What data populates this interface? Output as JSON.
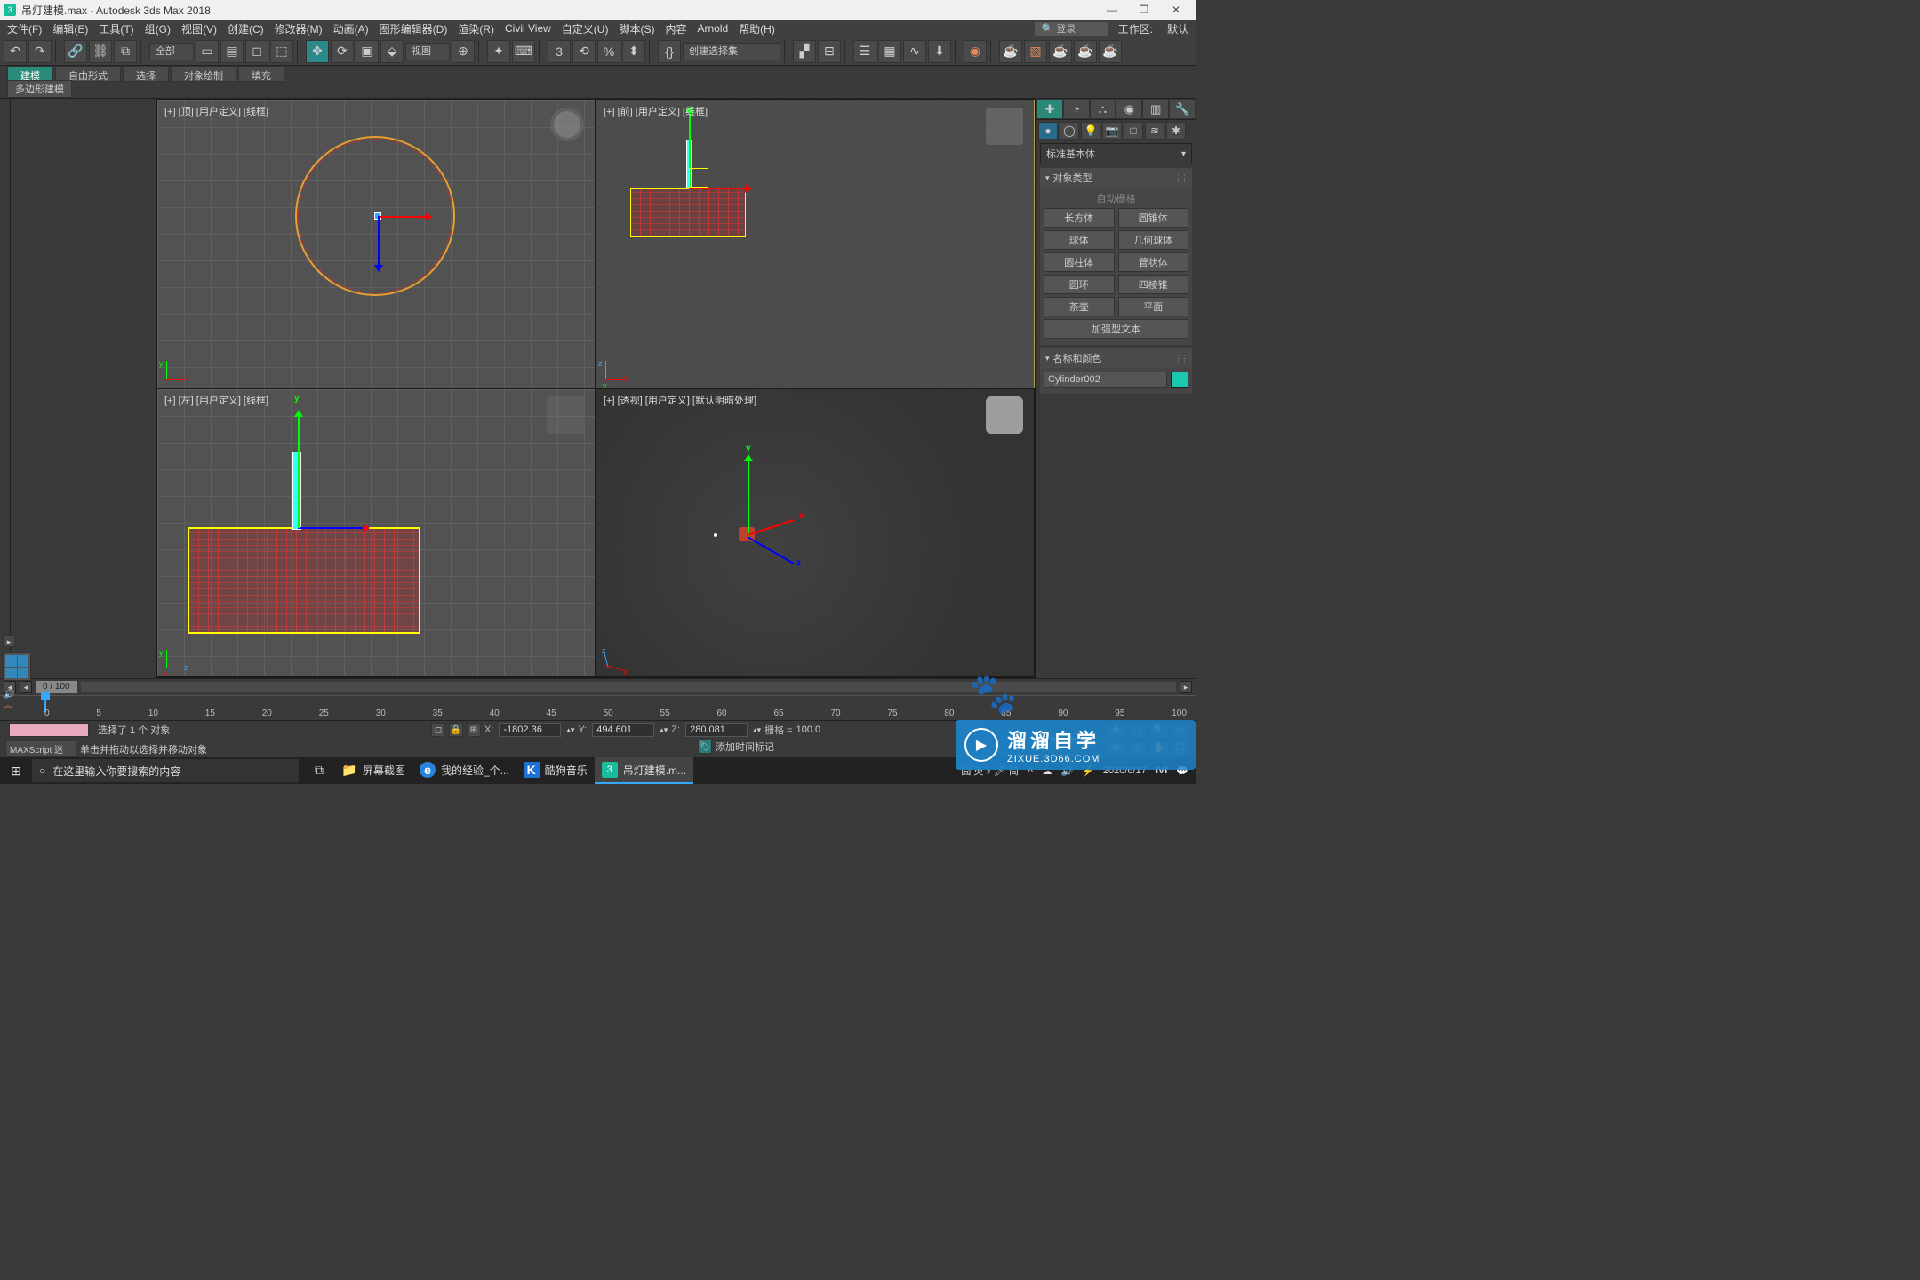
{
  "title": "吊灯建模.max - Autodesk 3ds Max 2018",
  "window": {
    "min": "—",
    "max": "❐",
    "close": "✕"
  },
  "menu": [
    "文件(F)",
    "编辑(E)",
    "工具(T)",
    "组(G)",
    "视图(V)",
    "创建(C)",
    "修改器(M)",
    "动画(A)",
    "图形编辑器(D)",
    "渲染(R)",
    "Civil View",
    "自定义(U)",
    "脚本(S)",
    "内容",
    "Arnold",
    "帮助(H)"
  ],
  "menuRight": {
    "search": "🔍 登录",
    "workspace_lbl": "工作区:",
    "workspace": "默认"
  },
  "toolbar": {
    "scope": "全部",
    "view": "视图",
    "namedsel": "创建选择集"
  },
  "ribbon": {
    "tabs": [
      "建模",
      "自由形式",
      "选择",
      "对象绘制",
      "填充"
    ],
    "sub": "多边形建模"
  },
  "viewports": {
    "vp1": "[+] [顶] [用户定义] [线框]",
    "vp2": "[+] [前] [用户定义] [线框]",
    "vp3": "[+] [左] [用户定义] [线框]",
    "vp4": "[+] [透视] [用户定义] [默认明暗处理]"
  },
  "cmd": {
    "dropdown": "标准基本体",
    "rollout1": "对象类型",
    "autogrid": "自动栅格",
    "types": [
      [
        "长方体",
        "圆锥体"
      ],
      [
        "球体",
        "几何球体"
      ],
      [
        "圆柱体",
        "管状体"
      ],
      [
        "圆环",
        "四棱锥"
      ],
      [
        "茶壶",
        "平面"
      ],
      [
        "加强型文本",
        ""
      ]
    ],
    "rollout2": "名称和颜色",
    "objname": "Cylinder002"
  },
  "timeline": {
    "frame": "0 / 100",
    "ticks": [
      "0",
      "5",
      "10",
      "15",
      "20",
      "25",
      "30",
      "35",
      "40",
      "45",
      "50",
      "55",
      "60",
      "65",
      "70",
      "75",
      "80",
      "85",
      "90",
      "95",
      "100"
    ]
  },
  "status": {
    "sel": "选择了 1 个 对象",
    "prompt": "单击并拖动以选择并移动对象",
    "maxscript": "MAXScript 迷",
    "x_lbl": "X:",
    "x": "-1802.36",
    "y_lbl": "Y:",
    "y": "494.601",
    "z_lbl": "Z:",
    "z": "280.081",
    "grid_lbl": "栅格 =",
    "grid": "100.0",
    "addtime": "添加时间标记"
  },
  "taskbar": {
    "search_ph": "在这里输入你要搜索的内容",
    "items": [
      {
        "icon": "📁",
        "label": "屏幕截图",
        "color": "#e8b030"
      },
      {
        "icon": "e",
        "label": "我的经验_个...",
        "color": "#2a82da"
      },
      {
        "icon": "K",
        "label": "酷狗音乐",
        "color": "#1e6fd8"
      },
      {
        "icon": "3",
        "label": "吊灯建模.m...",
        "color": "#1abc9c"
      }
    ],
    "tray": {
      "ime": "囧 英 ♪ 🖊 简",
      "date": "2020/6/17"
    }
  },
  "watermark": {
    "big": "溜溜自学",
    "small": "ZIXUE.3D66.COM"
  }
}
